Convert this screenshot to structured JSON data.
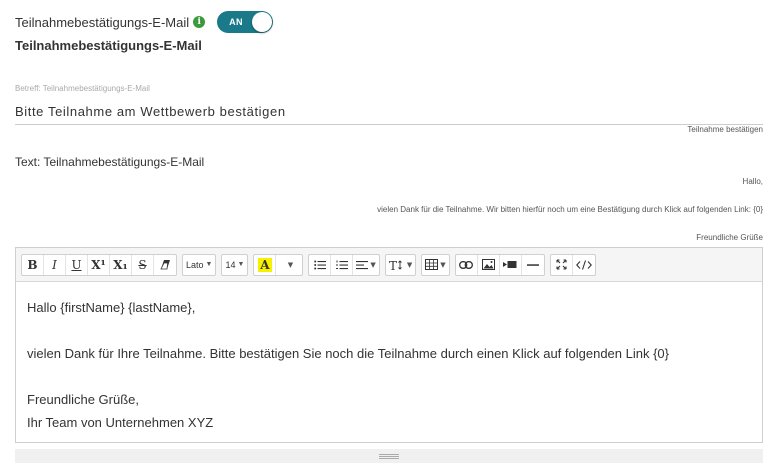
{
  "confirmation": {
    "top_label": "Teilnahmebestätigungs-E-Mail",
    "info_icon": "i",
    "toggle_label": "AN",
    "heading": "Teilnahmebestätigungs-E-Mail"
  },
  "subject": {
    "label": "Betreff: Teilnahmebestätigungs-E-Mail",
    "value": "Bitte Teilnahme am Wettbewerb bestätigen",
    "hint": "Teilnahme bestätigen"
  },
  "text": {
    "label": "Text: Teilnahmebestätigungs-E-Mail",
    "preview": {
      "line1": "Hallo,",
      "line2": "vielen Dank für die Teilnahme. Wir bitten hierfür noch um eine Bestätigung durch Klick auf folgenden Link: {0}",
      "line3": "Freundliche Grüße"
    }
  },
  "toolbar": {
    "bold": "B",
    "italic": "I",
    "underline": "U",
    "superscript": "X¹",
    "subscript": "X₁",
    "strikethrough": "S",
    "font_family": "Lato",
    "font_size": "14",
    "highlight": "A"
  },
  "editor": {
    "line1": "Hallo {firstName} {lastName},",
    "line2": "",
    "line3": "vielen Dank für Ihre Teilnahme. Bitte bestätigen Sie noch die Teilnahme durch einen Klick auf folgenden Link {0}",
    "line4": "",
    "line5": "Freundliche Grüße,",
    "line6": "Ihr Team von Unternehmen XYZ"
  },
  "colors": {
    "toggle_bg": "#1b7a8a",
    "info_icon": "#3c9a3c",
    "highlight": "#f7f100"
  }
}
